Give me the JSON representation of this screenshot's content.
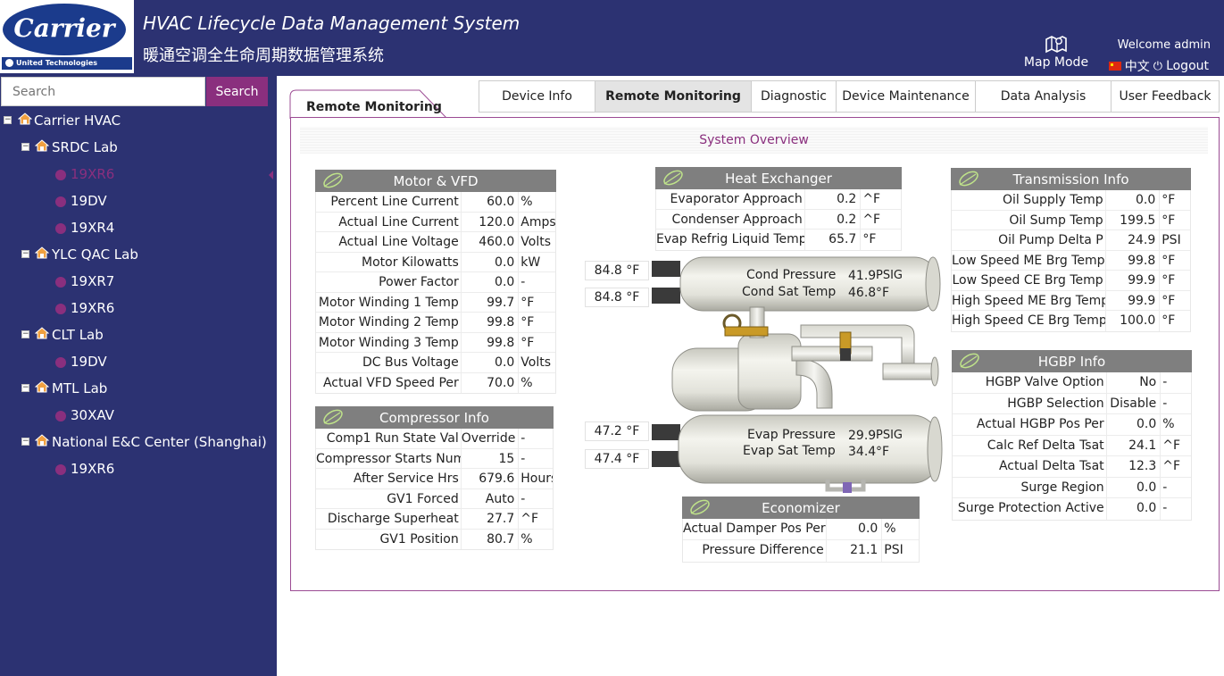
{
  "header": {
    "logo_text": "Carrier",
    "logo_sub": "United Technologies",
    "title_en": "HVAC Lifecycle Data Management System",
    "title_zh": "暖通空调全生命周期数据管理系统",
    "map_mode": "Map Mode",
    "welcome": "Welcome admin",
    "language": "中文",
    "logout": "Logout"
  },
  "search": {
    "placeholder": "Search",
    "button": "Search"
  },
  "tree": {
    "root": "Carrier HVAC",
    "groups": [
      {
        "label": "SRDC Lab",
        "children": [
          "19XR6",
          "19DV",
          "19XR4"
        ]
      },
      {
        "label": "YLC QAC Lab",
        "children": [
          "19XR7",
          "19XR6"
        ]
      },
      {
        "label": "CLT Lab",
        "children": [
          "19DV"
        ]
      },
      {
        "label": "MTL Lab",
        "children": [
          "30XAV"
        ]
      },
      {
        "label": "National E&C Center (Shanghai)",
        "children": [
          "19XR6"
        ]
      }
    ]
  },
  "active_tab": "Remote Monitoring",
  "tabs": [
    "Device Info",
    "Remote Monitoring",
    "Diagnostic",
    "Device Maintenance",
    "Data Analysis",
    "User Feedback"
  ],
  "system_overview": "System Overview",
  "motor": {
    "title": "Motor & VFD",
    "rows": [
      {
        "k": "Percent Line Current",
        "v": "60.0",
        "u": "%"
      },
      {
        "k": "Actual Line Current",
        "v": "120.0",
        "u": "Amps"
      },
      {
        "k": "Actual Line Voltage",
        "v": "460.0",
        "u": "Volts"
      },
      {
        "k": "Motor Kilowatts",
        "v": "0.0",
        "u": "kW"
      },
      {
        "k": "Power Factor",
        "v": "0.0",
        "u": "-"
      },
      {
        "k": "Motor Winding 1 Temp",
        "v": "99.7",
        "u": "°F"
      },
      {
        "k": "Motor Winding 2 Temp",
        "v": "99.8",
        "u": "°F"
      },
      {
        "k": "Motor Winding 3 Temp",
        "v": "99.8",
        "u": "°F"
      },
      {
        "k": "DC Bus Voltage",
        "v": "0.0",
        "u": "Volts"
      },
      {
        "k": "Actual VFD Speed Per",
        "v": "70.0",
        "u": "%"
      }
    ]
  },
  "compressor": {
    "title": "Compressor Info",
    "rows": [
      {
        "k": "Comp1 Run State Val",
        "v": "Override",
        "u": "-"
      },
      {
        "k": "Compressor Starts Num",
        "v": "15",
        "u": "-"
      },
      {
        "k": "After Service Hrs",
        "v": "679.6",
        "u": "Hours"
      },
      {
        "k": "GV1 Forced",
        "v": "Auto",
        "u": "-"
      },
      {
        "k": "Discharge Superheat",
        "v": "27.7",
        "u": "^F"
      },
      {
        "k": "GV1 Position",
        "v": "80.7",
        "u": "%"
      }
    ]
  },
  "heat_exchanger": {
    "title": "Heat Exchanger",
    "rows": [
      {
        "k": "Evaporator Approach",
        "v": "0.2",
        "u": "^F"
      },
      {
        "k": "Condenser Approach",
        "v": "0.2",
        "u": "^F"
      },
      {
        "k": "Evap Refrig Liquid Temp",
        "v": "65.7",
        "u": "°F"
      }
    ]
  },
  "transmission": {
    "title": "Transmission Info",
    "rows": [
      {
        "k": "Oil Supply Temp",
        "v": "0.0",
        "u": "°F"
      },
      {
        "k": "Oil Sump Temp",
        "v": "199.5",
        "u": "°F"
      },
      {
        "k": "Oil Pump Delta P",
        "v": "24.9",
        "u": "PSI"
      },
      {
        "k": "Low Speed ME Brg Temp",
        "v": "99.8",
        "u": "°F"
      },
      {
        "k": "Low Speed CE Brg Temp",
        "v": "99.9",
        "u": "°F"
      },
      {
        "k": "High Speed ME Brg Temp",
        "v": "99.9",
        "u": "°F"
      },
      {
        "k": "High Speed CE Brg Temp",
        "v": "100.0",
        "u": "°F"
      }
    ]
  },
  "hgbp": {
    "title": "HGBP Info",
    "rows": [
      {
        "k": "HGBP Valve Option",
        "v": "No",
        "u": "-"
      },
      {
        "k": "HGBP Selection",
        "v": "Disable",
        "u": "-"
      },
      {
        "k": "Actual HGBP Pos Per",
        "v": "0.0",
        "u": "%"
      },
      {
        "k": "Calc Ref Delta Tsat",
        "v": "24.1",
        "u": "^F"
      },
      {
        "k": "Actual Delta Tsat",
        "v": "12.3",
        "u": "^F"
      },
      {
        "k": "Surge Region",
        "v": "0.0",
        "u": "-"
      },
      {
        "k": "Surge Protection Active",
        "v": "0.0",
        "u": "-"
      }
    ]
  },
  "economizer": {
    "title": "Economizer",
    "rows": [
      {
        "k": "Actual Damper Pos Per",
        "v": "0.0",
        "u": "%"
      },
      {
        "k": "Pressure Difference",
        "v": "21.1",
        "u": "PSI"
      }
    ]
  },
  "condenser": {
    "water_in": "84.8 °F",
    "water_out": "84.8 °F",
    "pressure_label": "Cond Pressure",
    "pressure_value": "41.9",
    "pressure_unit": "PSIG",
    "sat_label": "Cond Sat Temp",
    "sat_value": "46.8",
    "sat_unit": "°F"
  },
  "evaporator": {
    "water_in": "47.2 °F",
    "water_out": "47.4 °F",
    "pressure_label": "Evap Pressure",
    "pressure_value": "29.9",
    "pressure_unit": "PSIG",
    "sat_label": "Evap Sat Temp",
    "sat_value": "34.4",
    "sat_unit": "°F"
  },
  "colors": {
    "navy": "#2c3272",
    "purple": "#8a2f7e",
    "card_header": "#7f7f7f"
  },
  "icons": [
    "home-icon",
    "leaf-icon",
    "map-icon",
    "power-icon",
    "flag-icon"
  ]
}
